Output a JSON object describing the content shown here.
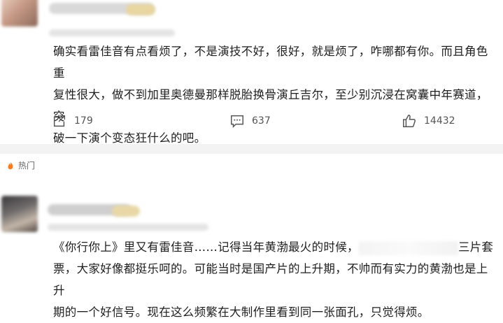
{
  "comment1": {
    "text_lines": [
      "确实看雷佳音有点看烦了，不是演技不好，很好，就是烦了，咋哪都有你。而且角色重",
      "复性很大，做不到加里奥德曼那样脱胎换骨演丘吉尔，至少别沉浸在窝囊中年赛道，突",
      "破一下演个变态狂什么的吧。"
    ],
    "share_count": "179",
    "comment_count": "637",
    "like_count": "14432"
  },
  "section": {
    "hot_label": "热门"
  },
  "comment2": {
    "line1_part1": "《你行你上》里又有雷佳音……记得当年黄渤最火的时候，",
    "line1_part2": "三片套",
    "line2": "票，大家好像都挺乐呵的。可能当时是国产片的上升期，不帅而有实力的黄渤也是上升",
    "line3": "期的一个好信号。现在这么频繁在大制作里看到同一张面孔，只觉得烦。"
  }
}
